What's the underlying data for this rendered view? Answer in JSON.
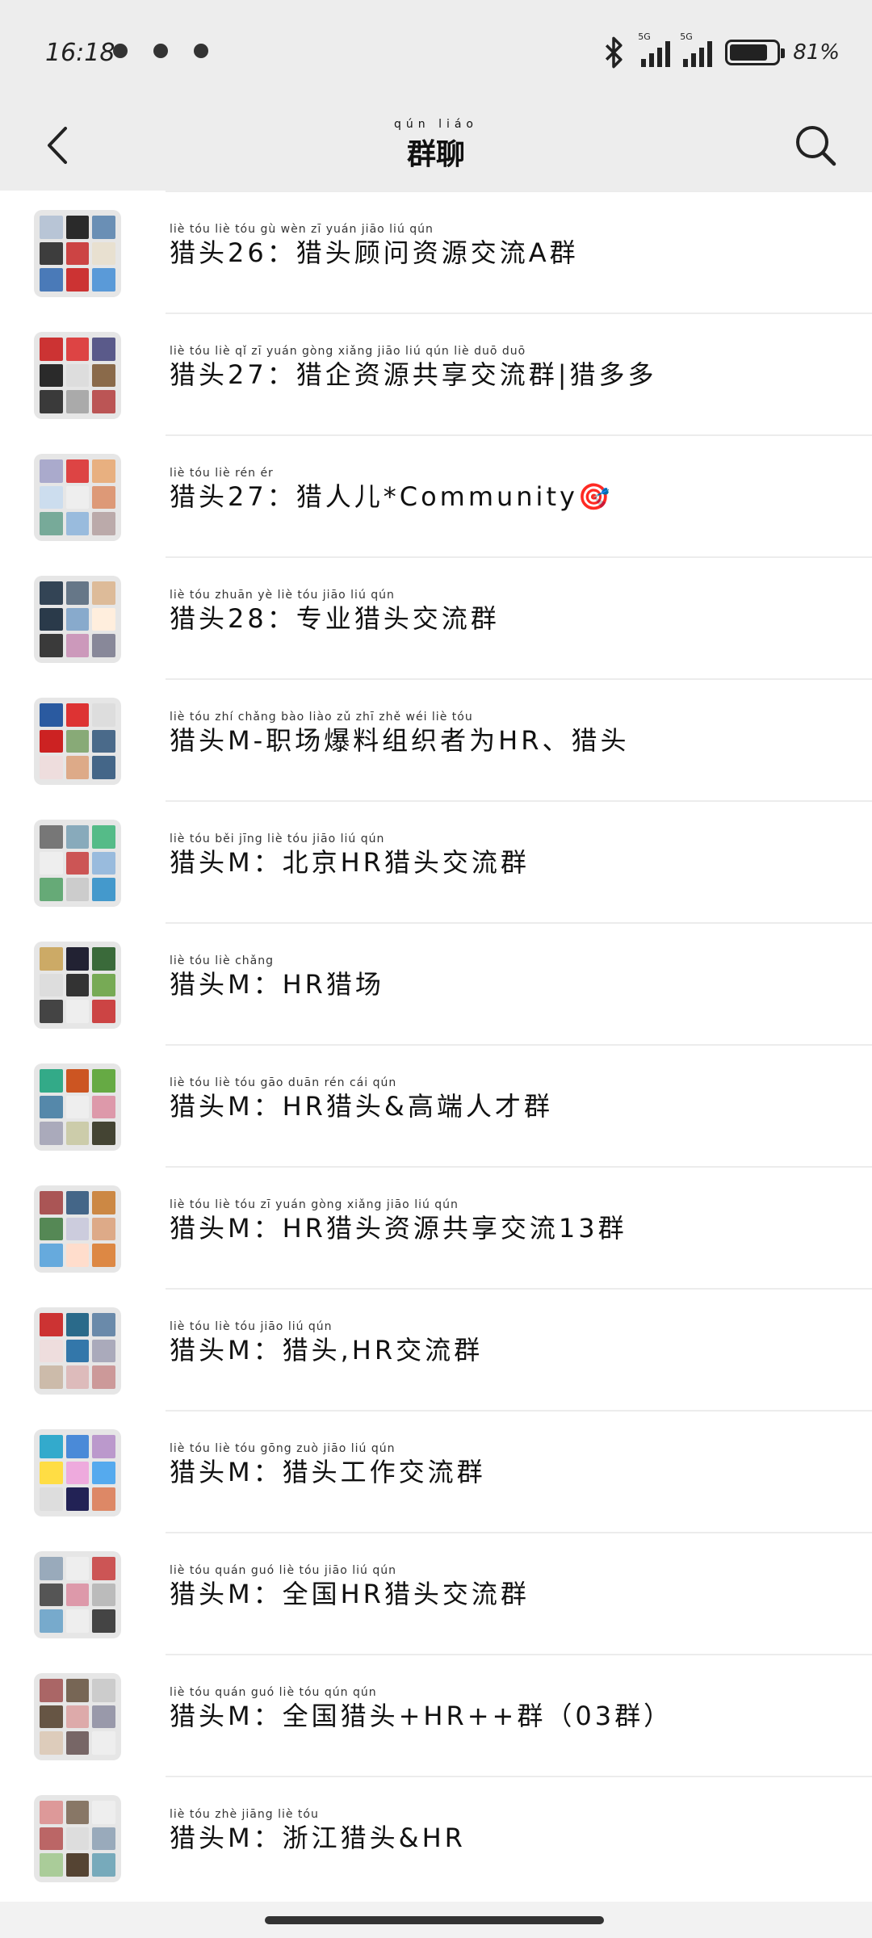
{
  "status_bar": {
    "time": "16:18",
    "network_1": "5G",
    "network_2": "5G",
    "battery_percent": "81%",
    "battery_level": 0.81
  },
  "header": {
    "title": "群聊",
    "title_pinyin": "qún liáo",
    "back_icon": "chevron-left-icon",
    "search_icon": "search-icon"
  },
  "groups": [
    {
      "name": "猎头26：猎头顾问资源交流A群",
      "pinyin": "liè tóu liè tóu gù wèn zī yuán jiāo liú qún",
      "colors": [
        "#b8c5d6",
        "#2a2a2a",
        "#6a8fb5",
        "#3d3d3d",
        "#c44",
        "#e8e0d0",
        "#4a7ab8",
        "#c33",
        "#5a9ad8"
      ]
    },
    {
      "name": "猎头27：猎企资源共享交流群|猎多多",
      "pinyin": "liè tóu liè qǐ zī yuán gòng xiǎng jiāo liú qún liè duō duō",
      "colors": [
        "#c33",
        "#d44",
        "#5a5a8a",
        "#2a2a2a",
        "#ddd",
        "#8a6a4a",
        "#3a3a3a",
        "#aaa",
        "#b55"
      ]
    },
    {
      "name": "猎头27：猎人儿*Community🎯",
      "pinyin": "liè tóu liè rén ér",
      "colors": [
        "#aac",
        "#d44",
        "#e8b080",
        "#cde",
        "#eee",
        "#d97",
        "#7a9",
        "#9bd",
        "#baa"
      ]
    },
    {
      "name": "猎头28：专业猎头交流群",
      "pinyin": "liè tóu zhuān yè liè tóu jiāo liú qún",
      "colors": [
        "#345",
        "#678",
        "#db9",
        "#2a3a4a",
        "#8ac",
        "#fed",
        "#3a3a3a",
        "#c9b",
        "#889"
      ]
    },
    {
      "name": "猎头M-职场爆料组织者为HR、猎头",
      "pinyin": "liè tóu zhí chǎng bào liào zǔ zhī zhě wéi liè tóu",
      "colors": [
        "#2a5aa0",
        "#d33",
        "#ddd",
        "#c22",
        "#8a7",
        "#4a6a8a",
        "#edd",
        "#da8",
        "#468"
      ]
    },
    {
      "name": "猎头M：北京HR猎头交流群",
      "pinyin": "liè tóu běi jīng liè tóu jiāo liú qún",
      "colors": [
        "#777",
        "#8ab",
        "#5b8",
        "#eee",
        "#c55",
        "#9bd",
        "#6a7",
        "#ccc",
        "#49c"
      ]
    },
    {
      "name": "猎头M：HR猎场",
      "pinyin": "liè tóu liè chǎng",
      "colors": [
        "#ca6",
        "#223",
        "#3a6a3a",
        "#ddd",
        "#333",
        "#7a5",
        "#444",
        "#eee",
        "#c44"
      ]
    },
    {
      "name": "猎头M：HR猎头&高端人才群",
      "pinyin": "liè tóu liè tóu gāo duān rén cái qún",
      "colors": [
        "#3a8",
        "#c52",
        "#6a4",
        "#58a",
        "#eee",
        "#d9a",
        "#aab",
        "#cca",
        "#443"
      ]
    },
    {
      "name": "猎头M：HR猎头资源共享交流13群",
      "pinyin": "liè tóu liè tóu zī yuán gòng xiǎng jiāo liú qún",
      "colors": [
        "#a55",
        "#468",
        "#c84",
        "#585",
        "#ccd",
        "#da8",
        "#6ad",
        "#fdc",
        "#d84"
      ]
    },
    {
      "name": "猎头M：猎头,HR交流群",
      "pinyin": "liè tóu liè tóu jiāo liú qún",
      "colors": [
        "#c33",
        "#2a6a8a",
        "#6a8aaa",
        "#edd",
        "#37a",
        "#aab",
        "#cba",
        "#dbb",
        "#c99"
      ]
    },
    {
      "name": "猎头M：猎头工作交流群",
      "pinyin": "liè tóu liè tóu gōng zuò jiāo liú qún",
      "colors": [
        "#3ac",
        "#4a8ad8",
        "#b9c",
        "#fd4",
        "#ead",
        "#5ae",
        "#ddd",
        "#225",
        "#d86"
      ]
    },
    {
      "name": "猎头M：全国HR猎头交流群",
      "pinyin": "liè tóu quán guó liè tóu jiāo liú qún",
      "colors": [
        "#9ab",
        "#eee",
        "#c55",
        "#555",
        "#d9a",
        "#bbb",
        "#7ac",
        "#eee",
        "#444"
      ]
    },
    {
      "name": "猎头M：全国猎头+HR++群（03群）",
      "pinyin": "liè tóu quán guó liè tóu qún qún",
      "colors": [
        "#a66",
        "#765",
        "#ccc",
        "#654",
        "#daa",
        "#99a",
        "#dcb",
        "#766",
        "#eee"
      ]
    },
    {
      "name": "猎头M：浙江猎头&HR",
      "pinyin": "liè tóu zhè jiāng liè tóu",
      "colors": [
        "#d99",
        "#876",
        "#eee",
        "#b66",
        "#ddd",
        "#9ab",
        "#ac9",
        "#543",
        "#7ab"
      ]
    }
  ]
}
